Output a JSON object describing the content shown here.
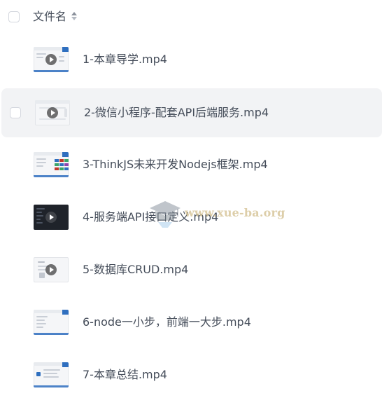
{
  "header": {
    "title": "文件名"
  },
  "files": [
    {
      "name": "1-本章导学.mp4"
    },
    {
      "name": "2-微信小程序-配套API后端服务.mp4"
    },
    {
      "name": "3-ThinkJS未来开发Nodejs框架.mp4"
    },
    {
      "name": "4-服务端API接口定义.mp4"
    },
    {
      "name": "5-数据库CRUD.mp4"
    },
    {
      "name": "6-node一小步，前端一大步.mp4"
    },
    {
      "name": "7-本章总结.mp4"
    }
  ],
  "watermark": {
    "text": "www.xue-ba.org"
  },
  "colors": {
    "text": "#454d5a",
    "row_hover_bg": "#f2f3f5",
    "checkbox_border": "#d4d7de",
    "accent_blue": "#2f6fbf"
  }
}
